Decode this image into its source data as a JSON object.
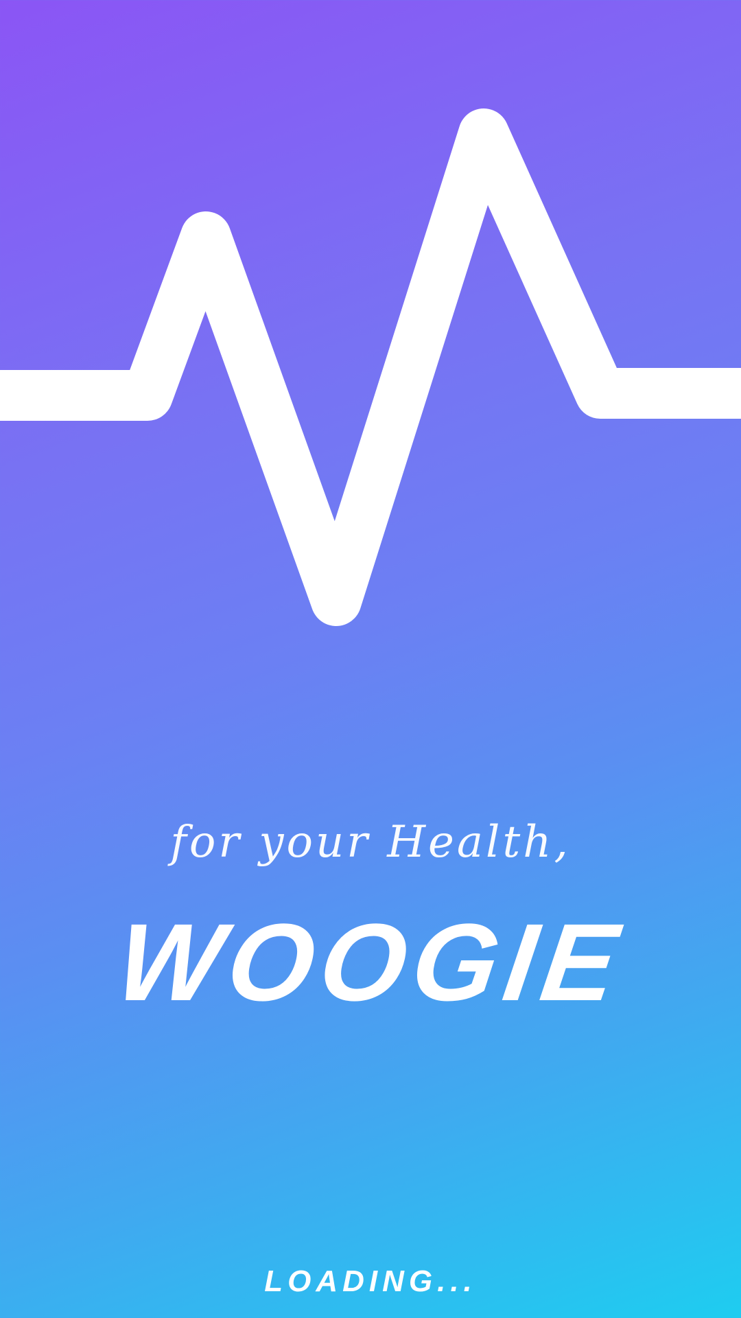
{
  "splash": {
    "tagline": "for your Health,",
    "brand": "WOOGIE",
    "loading": "LOADING..."
  },
  "icons": {
    "logo": "heartbeat-pulse-icon"
  },
  "colors": {
    "gradient_top": "#8B55F5",
    "gradient_middle": "#6B80F3",
    "gradient_bottom": "#1ECDF0",
    "foreground": "#FFFFFF"
  }
}
